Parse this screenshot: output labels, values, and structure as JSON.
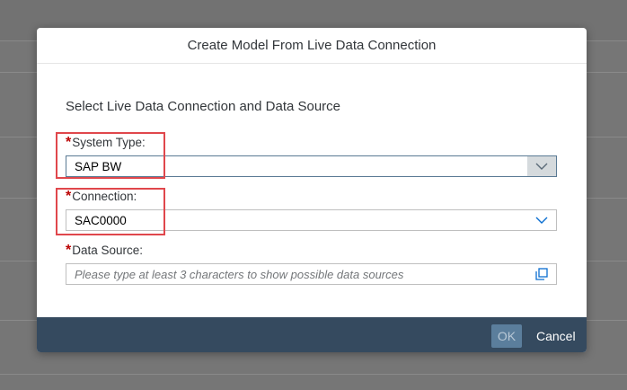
{
  "dialog": {
    "title": "Create Model From Live Data Connection",
    "section_title": "Select Live Data Connection and Data Source",
    "required_marker": "*",
    "system_type": {
      "label": "System Type:",
      "value": "SAP BW"
    },
    "connection": {
      "label": "Connection:",
      "value": "SAC0000"
    },
    "data_source": {
      "label": "Data Source:",
      "placeholder": "Please type at least 3 characters to show possible data sources"
    },
    "footer": {
      "ok_label": "OK",
      "cancel_label": "Cancel"
    }
  },
  "icons": {
    "system_type_dropdown": "chevron-down-icon",
    "connection_dropdown": "chevron-down-icon",
    "data_source_value_help": "value-help-icon"
  },
  "colors": {
    "footer_bg": "#354a5f",
    "required": "#bb0000",
    "highlight": "#e0474c",
    "ok_button": "#5b7e9c",
    "chevron": "#0a6ed1"
  }
}
